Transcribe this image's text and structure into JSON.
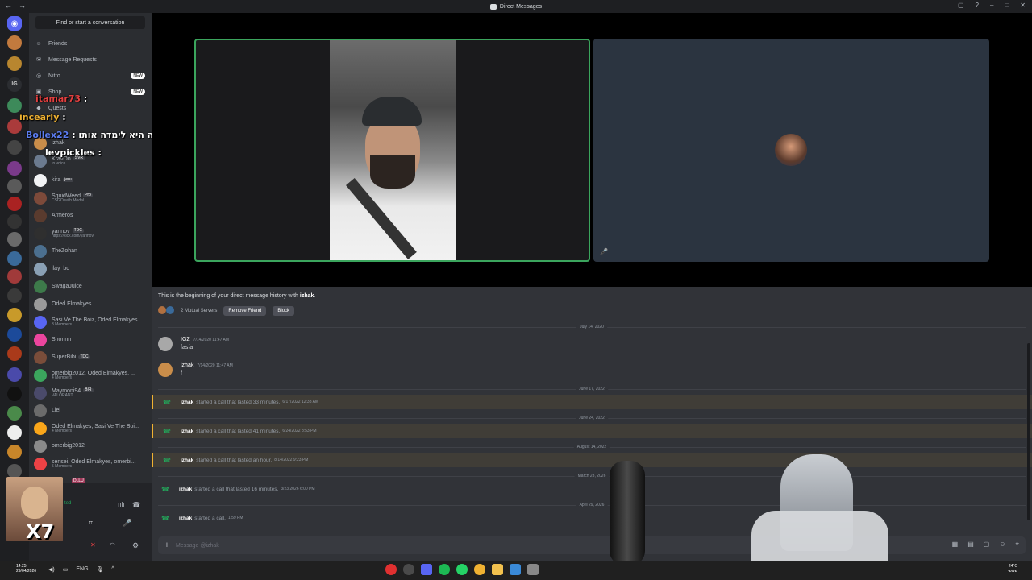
{
  "window": {
    "title": "Direct Messages",
    "nav_back": "←",
    "nav_fwd": "→"
  },
  "sidebar": {
    "find_placeholder": "Find or start a conversation",
    "nav": [
      {
        "label": "Friends",
        "badge": ""
      },
      {
        "label": "Message Requests",
        "badge": ""
      },
      {
        "label": "Nitro",
        "badge": "NEW"
      },
      {
        "label": "Shop",
        "badge": "NEW"
      },
      {
        "label": "Quests",
        "badge": ""
      }
    ],
    "dms": [
      {
        "name": "izhak",
        "sub": "",
        "tag": "",
        "color": "#c98d4a"
      },
      {
        "name": "KravOn",
        "sub": "In voice",
        "tag": "SVR",
        "color": "#6b7a8f"
      },
      {
        "name": "kira",
        "sub": "",
        "tag": "jeru",
        "color": "#f2f3f5"
      },
      {
        "name": "SquidWeed",
        "sub": "CSGO with Medal",
        "tag": "Pro",
        "color": "#7d4a3a"
      },
      {
        "name": "Armeros",
        "sub": "",
        "tag": "",
        "color": "#5a3b2e"
      },
      {
        "name": "yarinov",
        "sub": "https://kick.com/yarinov",
        "tag": "TDC",
        "color": "#2f2f2f"
      },
      {
        "name": "TheZohan",
        "sub": "",
        "tag": "",
        "color": "#4b6f8f"
      },
      {
        "name": "ilay_bc",
        "sub": "",
        "tag": "",
        "color": "#8aa0b5"
      },
      {
        "name": "SwagaJuice",
        "sub": "",
        "tag": "",
        "color": "#3d7a4a"
      },
      {
        "name": "Oded Elmakyes",
        "sub": "",
        "tag": "",
        "color": "#9a9a9a"
      },
      {
        "name": "Sasi Ve The Boiz, Oded Elmakyes",
        "sub": "3 Members",
        "tag": "",
        "color": "#5865f2"
      },
      {
        "name": "Shonnn",
        "sub": "",
        "tag": "",
        "color": "#eb459e"
      },
      {
        "name": "SuperBibi",
        "sub": "",
        "tag": "TDC",
        "color": "#7a4d3a"
      },
      {
        "name": "omerbig2012, Oded Elmakyes, ...",
        "sub": "4 Members",
        "tag": "",
        "color": "#3ba55d"
      },
      {
        "name": "Maymoni94",
        "sub": "VALORANT",
        "tag": "BIR",
        "color": "#4a4a6a"
      },
      {
        "name": "Liel",
        "sub": "",
        "tag": "",
        "color": "#6b6b6b"
      },
      {
        "name": "Oded Elmakyes, Sasi Ve The Boi...",
        "sub": "4 Members",
        "tag": "",
        "color": "#faa61a"
      },
      {
        "name": "omerbig2012",
        "sub": "",
        "tag": "",
        "color": "#8a8a8a"
      },
      {
        "name": "sensei, Oded Elmakyes, omerbi...",
        "sub": "5 Members",
        "tag": "",
        "color": "#ed4245"
      }
    ],
    "user_tag": "DLLU",
    "user_status": "ted"
  },
  "stream_overlay": {
    "lines": [
      {
        "user": "itamar73",
        "color": "#e34040",
        "text": " :"
      },
      {
        "user": "incearly",
        "color": "#f0b232",
        "text": " :"
      },
      {
        "user": "Bollex22",
        "color": "#5b7cf0",
        "text": " : מה היא לימדה אותו"
      },
      {
        "user": "levpickles",
        "color": "#ffffff",
        "text": " :"
      }
    ],
    "webcam_label": "X7"
  },
  "call": {
    "mute_icon": "🎤"
  },
  "chat": {
    "beginning_prefix": "This is the beginning of your direct message history with ",
    "beginning_user": "izhak",
    "beginning_suffix": ".",
    "mutual_servers": "2 Mutual Servers",
    "remove_friend": "Remove Friend",
    "block": "Block",
    "dates": [
      "July 14, 2020",
      "June 17, 2022",
      "June 24, 2022",
      "August 14, 2022",
      "March 23, 2026",
      "April 29, 2026"
    ],
    "messages": [
      {
        "author": "IGZ",
        "ts": "7/14/2020 11:47 AM",
        "body": "fasfa",
        "color": "#a8a8a8"
      },
      {
        "author": "izhak",
        "ts": "7/14/2020 11:47 AM",
        "body": "f",
        "color": "#c98d4a"
      }
    ],
    "calls": [
      {
        "who": "izhak",
        "text": "started a call that lasted 33 minutes.",
        "ts": "6/17/2022 12:38 AM",
        "missed": true
      },
      {
        "who": "izhak",
        "text": "started a call that lasted 41 minutes.",
        "ts": "6/24/2022 8:53 PM",
        "missed": true
      },
      {
        "who": "izhak",
        "text": "started a call that lasted an hour.",
        "ts": "8/14/2022 9:23 PM",
        "missed": true
      },
      {
        "who": "izhak",
        "text": "started a call that lasted 16 minutes.",
        "ts": "3/23/2026 6:00 PM",
        "missed": false
      },
      {
        "who": "izhak",
        "text": "started a call.",
        "ts": "1:59 PM",
        "missed": false
      }
    ],
    "composer_placeholder": "Message @izhak"
  },
  "taskbar": {
    "time": "14:25",
    "date": "29/04/2026",
    "lang": "ENG",
    "weather": "24°C",
    "weather_sub": "שמשי"
  }
}
